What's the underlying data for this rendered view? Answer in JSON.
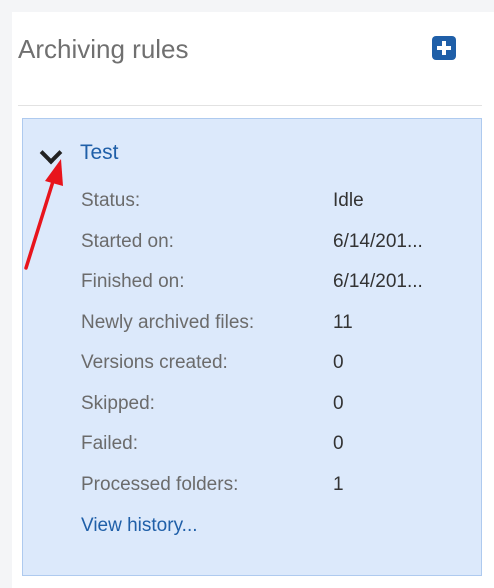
{
  "header": {
    "title": "Archiving rules",
    "add_icon": "plus-square-icon"
  },
  "rule": {
    "name": "Test",
    "expand_icon": "chevron-down-icon",
    "properties": [
      {
        "label": "Status:",
        "value": "Idle"
      },
      {
        "label": "Started on:",
        "value": "6/14/201..."
      },
      {
        "label": "Finished on:",
        "value": "6/14/201..."
      },
      {
        "label": "Newly archived files:",
        "value": "11"
      },
      {
        "label": "Versions created:",
        "value": "0"
      },
      {
        "label": "Skipped:",
        "value": "0"
      },
      {
        "label": "Failed:",
        "value": "0"
      },
      {
        "label": "Processed folders:",
        "value": "1"
      }
    ],
    "view_history_label": "View history..."
  },
  "annotation": {
    "icon": "red-arrow-annotation",
    "color": "#e8141c"
  },
  "colors": {
    "accent": "#1f5fa8",
    "card_background": "#dce9fb",
    "card_border": "#aecaef"
  }
}
